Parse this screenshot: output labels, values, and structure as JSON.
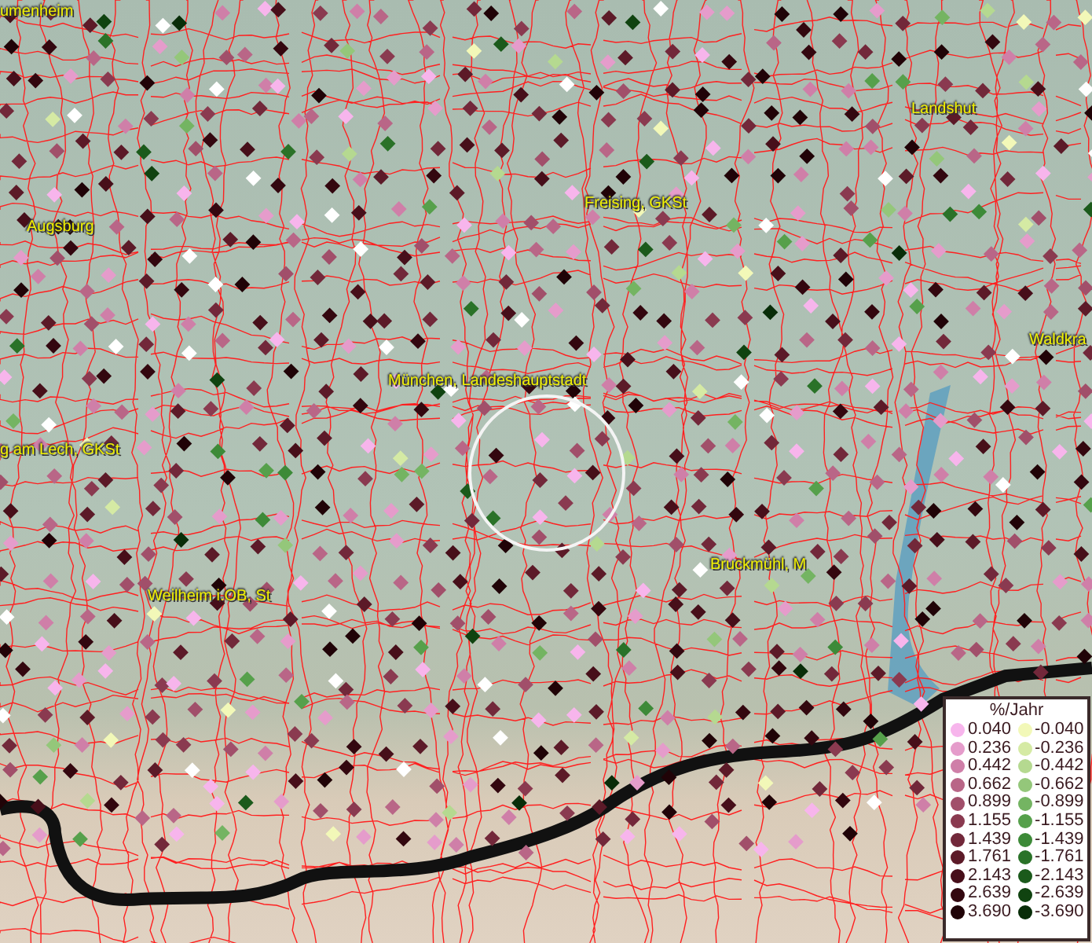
{
  "map": {
    "place_labels": [
      {
        "text": "umenheim"
      },
      {
        "text": "Landshut"
      },
      {
        "text": "Augsburg"
      },
      {
        "text": "Freising, GKSt"
      },
      {
        "text": "München, Landeshauptstadt"
      },
      {
        "text": "Waldkra"
      },
      {
        "text": "g am Lech, GKSt"
      },
      {
        "text": "Bruckmühl, M"
      },
      {
        "text": "Weilheim i.OB, St"
      }
    ]
  },
  "legend": {
    "title": "%/Jahr",
    "positive": [
      {
        "value": "0.040",
        "color": "#f7b5ec"
      },
      {
        "value": "0.236",
        "color": "#e59ccb"
      },
      {
        "value": "0.442",
        "color": "#cf7fa8"
      },
      {
        "value": "0.662",
        "color": "#b96687"
      },
      {
        "value": "0.899",
        "color": "#a14f6a"
      },
      {
        "value": "1.155",
        "color": "#8a3a50"
      },
      {
        "value": "1.439",
        "color": "#72283a"
      },
      {
        "value": "1.761",
        "color": "#5c1a28"
      },
      {
        "value": "2.143",
        "color": "#470f1a"
      },
      {
        "value": "2.639",
        "color": "#33070f"
      },
      {
        "value": "3.690",
        "color": "#200307"
      }
    ],
    "negative": [
      {
        "value": "-0.040",
        "color": "#f2f8b8"
      },
      {
        "value": "-0.236",
        "color": "#d5eaa4"
      },
      {
        "value": "-0.442",
        "color": "#b5d990"
      },
      {
        "value": "-0.662",
        "color": "#94c77a"
      },
      {
        "value": "-0.899",
        "color": "#74b462"
      },
      {
        "value": "-1.155",
        "color": "#56a04b"
      },
      {
        "value": "-1.439",
        "color": "#3d8a38"
      },
      {
        "value": "-1.761",
        "color": "#2a7228"
      },
      {
        "value": "-2.143",
        "color": "#1b5a1b"
      },
      {
        "value": "-2.639",
        "color": "#104310"
      },
      {
        "value": "-3.690",
        "color": "#082d08"
      }
    ]
  }
}
